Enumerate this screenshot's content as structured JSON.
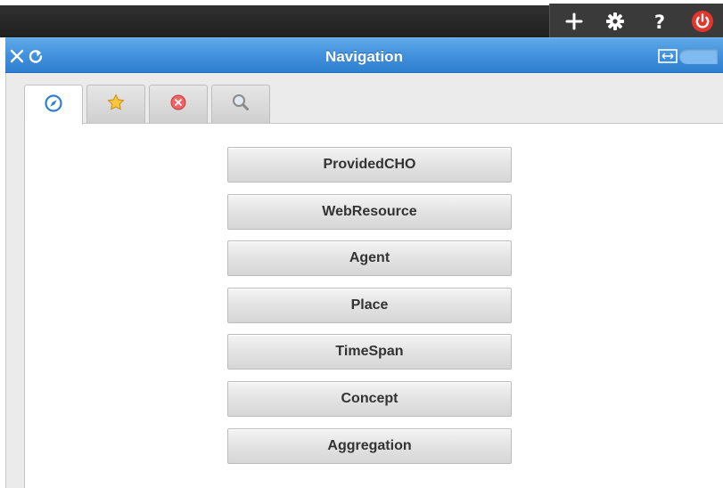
{
  "topbar": {
    "tools": [
      {
        "icon": "plus-icon",
        "glyph": "+"
      },
      {
        "icon": "gear-icon",
        "glyph": "✹"
      },
      {
        "icon": "help-icon",
        "glyph": "?"
      },
      {
        "icon": "power-icon",
        "glyph": "⏻"
      }
    ]
  },
  "header": {
    "title": "Navigation",
    "close_icon": "close-icon",
    "refresh_icon": "refresh-icon",
    "expand_icon": "expand-width-icon",
    "accent": "#3f8fdc"
  },
  "tabs": [
    {
      "icon": "compass-icon",
      "active": true
    },
    {
      "icon": "star-icon",
      "active": false
    },
    {
      "icon": "error-icon",
      "active": false
    },
    {
      "icon": "search-icon",
      "active": false
    }
  ],
  "buttons": [
    "ProvidedCHO",
    "WebResource",
    "Agent",
    "Place",
    "TimeSpan",
    "Concept",
    "Aggregation"
  ]
}
